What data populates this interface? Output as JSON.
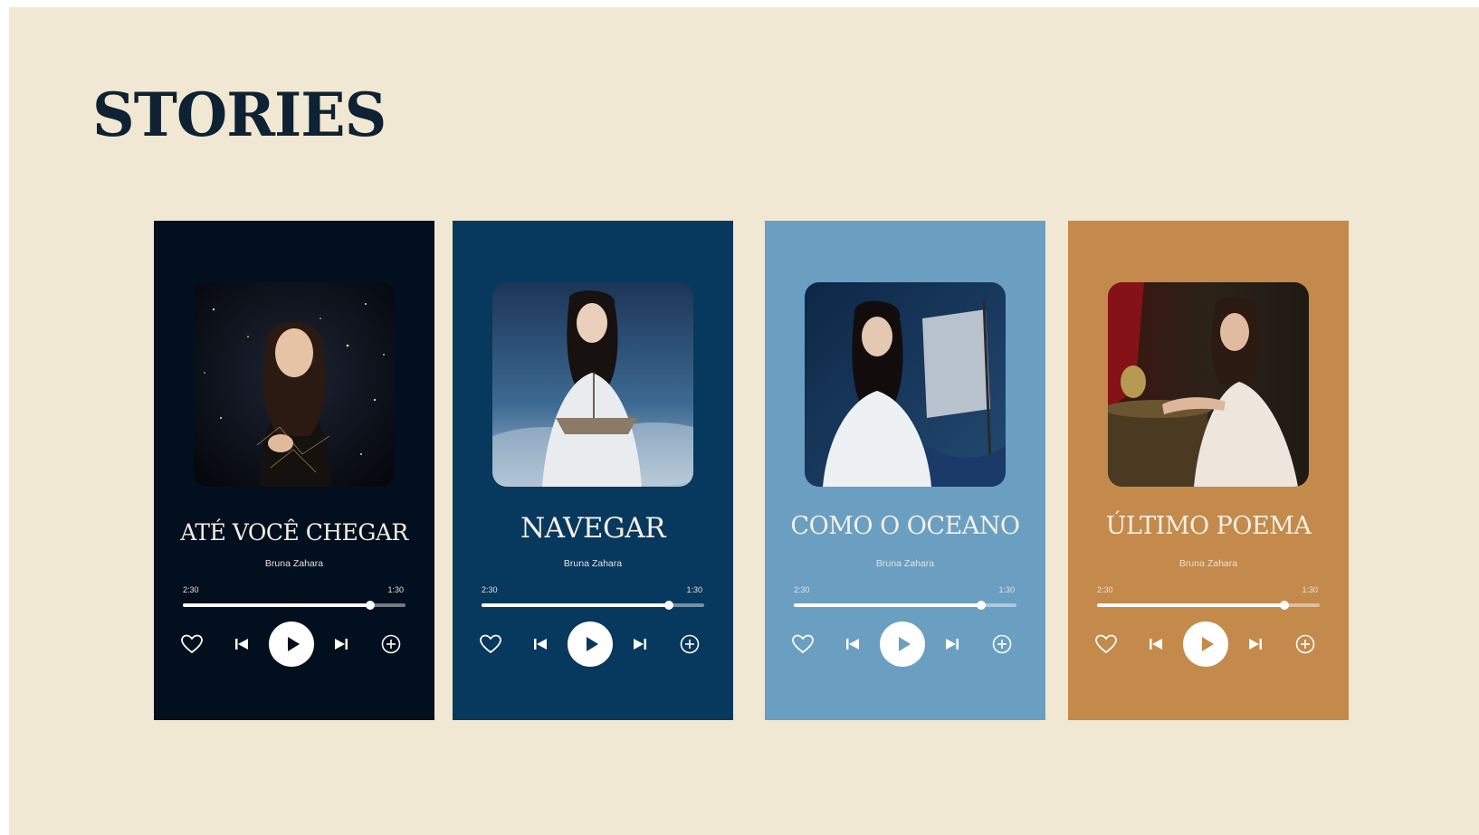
{
  "page": {
    "title": "STORIES"
  },
  "cards": [
    {
      "title": "ATÉ VOCÊ CHEGAR",
      "artist": "Bruna Zahara",
      "elapsed": "2:30",
      "remaining": "1:30",
      "progress": 0.84,
      "bg": "#020f1e",
      "play_icon_color": "#020f1e"
    },
    {
      "title": "NAVEGAR",
      "artist": "Bruna Zahara",
      "elapsed": "2:30",
      "remaining": "1:30",
      "progress": 0.84,
      "bg": "#07385e",
      "play_icon_color": "#07385e"
    },
    {
      "title": "COMO O OCEANO",
      "artist": "Bruna Zahara",
      "elapsed": "2:30",
      "remaining": "1:30",
      "progress": 0.84,
      "bg": "#6a9fc2",
      "play_icon_color": "#6a9fc2"
    },
    {
      "title": "ÚLTIMO POEMA",
      "artist": "Bruna Zahara",
      "elapsed": "2:30",
      "remaining": "1:30",
      "progress": 0.84,
      "bg": "#c38a4c",
      "play_icon_color": "#c38a4c"
    }
  ],
  "icons": {
    "like": "heart-icon",
    "previous": "skip-previous-icon",
    "play": "play-icon",
    "next": "skip-next-icon",
    "add": "plus-circle-icon"
  }
}
